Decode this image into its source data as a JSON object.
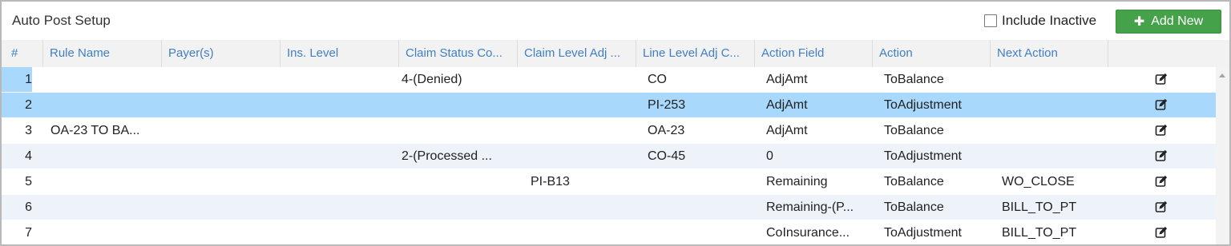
{
  "header": {
    "title": "Auto Post Setup",
    "include_inactive_label": "Include Inactive",
    "add_new_label": "Add New"
  },
  "columns": [
    "#",
    "Rule Name",
    "Payer(s)",
    "Ins. Level",
    "Claim Status Co...",
    "Claim Level Adj ...",
    "Line Level Adj C...",
    "Action Field",
    "Action",
    "Next Action"
  ],
  "rows": [
    {
      "num": "1",
      "rule_name": "",
      "payers": "",
      "ins_level": "",
      "claim_status": "4-(Denied)",
      "claim_level_adj": "",
      "line_level_adj": "CO",
      "action_field": "AdjAmt",
      "action": "ToBalance",
      "next_action": ""
    },
    {
      "num": "2",
      "rule_name": "",
      "payers": "",
      "ins_level": "",
      "claim_status": "",
      "claim_level_adj": "",
      "line_level_adj": "PI-253",
      "action_field": "AdjAmt",
      "action": "ToAdjustment",
      "next_action": ""
    },
    {
      "num": "3",
      "rule_name": "OA-23 TO BA...",
      "payers": "",
      "ins_level": "",
      "claim_status": "",
      "claim_level_adj": "",
      "line_level_adj": "OA-23",
      "action_field": "AdjAmt",
      "action": "ToBalance",
      "next_action": ""
    },
    {
      "num": "4",
      "rule_name": "",
      "payers": "",
      "ins_level": "",
      "claim_status": "2-(Processed ...",
      "claim_level_adj": "",
      "line_level_adj": "CO-45",
      "action_field": "0",
      "action": "ToAdjustment",
      "next_action": ""
    },
    {
      "num": "5",
      "rule_name": "",
      "payers": "",
      "ins_level": "",
      "claim_status": "",
      "claim_level_adj": "PI-B13",
      "line_level_adj": "",
      "action_field": "Remaining",
      "action": "ToBalance",
      "next_action": "WO_CLOSE"
    },
    {
      "num": "6",
      "rule_name": "",
      "payers": "",
      "ins_level": "",
      "claim_status": "",
      "claim_level_adj": "",
      "line_level_adj": "",
      "action_field": "Remaining-(P...",
      "action": "ToBalance",
      "next_action": "BILL_TO_PT"
    },
    {
      "num": "7",
      "rule_name": "",
      "payers": "",
      "ins_level": "",
      "claim_status": "",
      "claim_level_adj": "",
      "line_level_adj": "",
      "action_field": "CoInsurance...",
      "action": "ToAdjustment",
      "next_action": "BILL_TO_PT"
    }
  ],
  "selected_row": "2",
  "icons": {
    "edit": "edit-icon",
    "add": "plus-icon",
    "checkbox": "checkbox-icon"
  },
  "colors": {
    "accent": "#3f7fc7",
    "add_button": "#46a24a",
    "selected_row": "#a8d8fb",
    "alt_row": "#eef3f9"
  }
}
